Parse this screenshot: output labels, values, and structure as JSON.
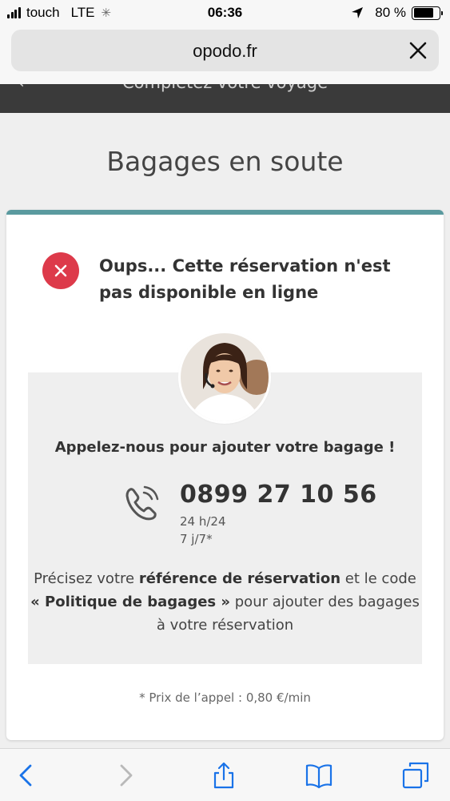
{
  "status_bar": {
    "carrier": "touch",
    "network": "LTE",
    "time": "06:36",
    "battery": "80 %",
    "battery_level": 0.8
  },
  "browser": {
    "url": "opodo.fr",
    "close_icon": "close-icon"
  },
  "header": {
    "title": "Complétez votre voyage"
  },
  "page": {
    "title": "Bagages en soute"
  },
  "error": {
    "message": "Oups... Cette réservation n'est pas disponible en ligne",
    "icon": "x-circle-icon",
    "color": "#dd3a4a"
  },
  "contact": {
    "call_text": "Appelez-nous pour ajouter votre bagage !",
    "phone": "0899 27 10 56",
    "hours": "24 h/24",
    "days": "7 j/7*",
    "instr_1": "Précisez votre ",
    "instr_bold_1": "référence de réservation",
    "instr_2": " et le code ",
    "instr_bold_2": "« Politique de bagages »",
    "instr_3": " pour ajouter des bagages à votre réservation"
  },
  "footer": {
    "price_note": "* Prix de l’appel : 0,80 €/min"
  },
  "colors": {
    "accent": "#5a9a9f",
    "ios_blue": "#1a73e8"
  }
}
